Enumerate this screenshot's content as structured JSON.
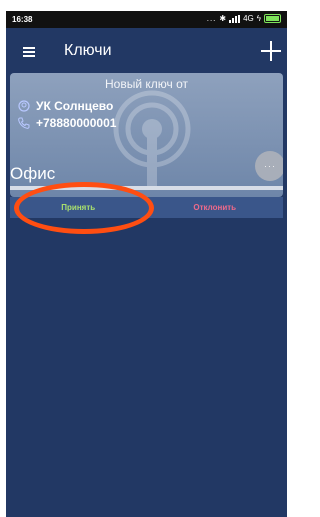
{
  "status_bar": {
    "time": "16:38",
    "network": "4G",
    "overflow_indicator": "..."
  },
  "app_bar": {
    "title": "Ключи",
    "menu_icon": "menu-icon",
    "add_icon": "plus-icon"
  },
  "key_card": {
    "header": "Новый ключ от",
    "org_name": "УК Солнцево",
    "phone": "+78880000001",
    "office": "Офис",
    "more_label": "···"
  },
  "actions": {
    "accept_label": "Принять",
    "decline_label": "Отклонить"
  },
  "colors": {
    "background": "#223864",
    "card": "#8ea1bd",
    "accept": "#a9e06e",
    "decline": "#ef6a8a",
    "annotation": "#ff4e12"
  }
}
